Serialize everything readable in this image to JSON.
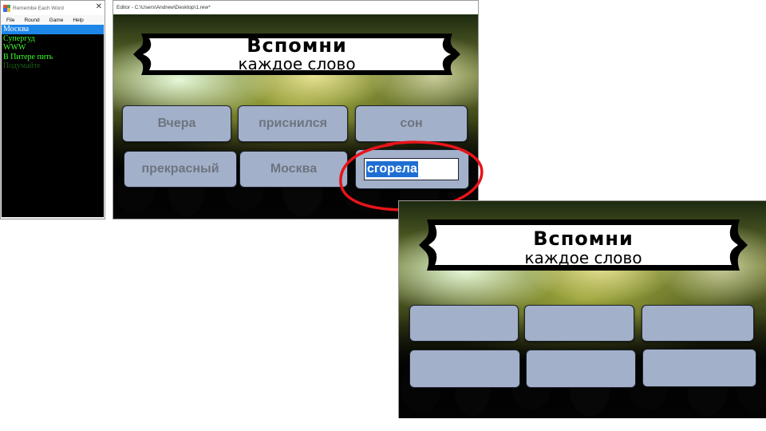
{
  "app_window": {
    "title": "Remembe Each Word",
    "close_glyph": "✕",
    "menu": [
      "File",
      "Round",
      "Game",
      "Help"
    ],
    "list_items": [
      {
        "text": "Москва",
        "selected": true
      },
      {
        "text": "Супергуд",
        "selected": false
      },
      {
        "text": "WWW",
        "selected": false
      },
      {
        "text": "В Питере пить",
        "selected": false
      },
      {
        "text": "Подумайте",
        "selected": false,
        "faded": true
      }
    ]
  },
  "editor": {
    "title": "Editor - C:\\Users\\Andrew\\Desktop\\1.rew*",
    "banner": {
      "line1": "Вспомни",
      "line2": "каждое слово"
    },
    "tiles": [
      "Вчера",
      "приснился",
      "сон",
      "прекрасный",
      "Москва"
    ],
    "editing_value": "сгорела"
  },
  "preview": {
    "banner": {
      "line1": "Вспомни",
      "line2": "каждое слово"
    },
    "tiles": [
      "",
      "",
      "",
      "",
      "",
      ""
    ]
  },
  "colors": {
    "tile_fill": "#a3b0c9",
    "tile_text": "#6d7480",
    "list_text": "#3cff28",
    "selection": "#1d86e8",
    "annotation": "#e8141a"
  }
}
